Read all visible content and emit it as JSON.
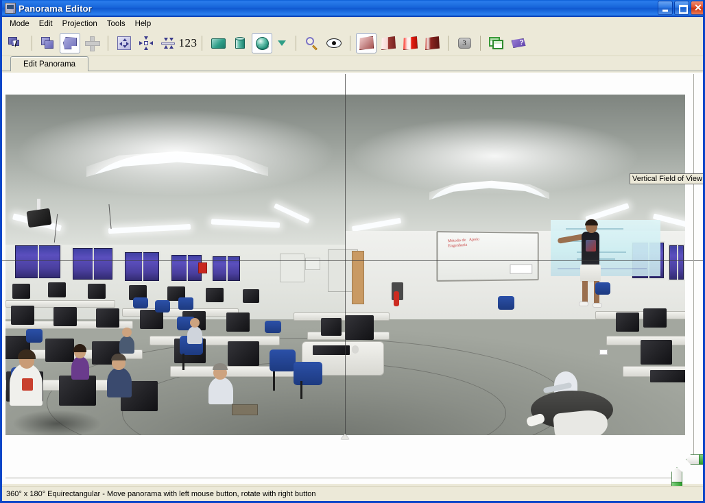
{
  "window": {
    "title": "Panorama Editor",
    "icon": "application-icon",
    "buttons": {
      "minimize": "minimize-button",
      "maximize": "maximize-restore-button",
      "close": "✕"
    }
  },
  "menubar": {
    "items": [
      {
        "label": "Mode"
      },
      {
        "label": "Edit"
      },
      {
        "label": "Projection"
      },
      {
        "label": "Tools"
      },
      {
        "label": "Help"
      }
    ]
  },
  "toolbar": {
    "groups": [
      {
        "name": "selection",
        "items": [
          {
            "icon": "select-arrow-icon",
            "label": "Select",
            "selected": false
          },
          {
            "icon": "layers-icon",
            "label": "Layers",
            "selected": false
          },
          {
            "icon": "shape-region-icon",
            "label": "Region",
            "selected": true
          },
          {
            "icon": "crosshair-add-icon",
            "label": "Add Point",
            "selected": false
          }
        ]
      },
      {
        "name": "transform",
        "items": [
          {
            "icon": "move-all-directions-icon",
            "label": "Move",
            "selected": false
          },
          {
            "icon": "center-shrink-icon",
            "label": "Center",
            "selected": false
          },
          {
            "icon": "vertical-fit-icon",
            "label": "Vertical Fit",
            "selected": false
          },
          {
            "icon": "numeric-values-icon",
            "label": "123",
            "selected": false
          }
        ]
      },
      {
        "name": "projection",
        "items": [
          {
            "icon": "rectangle-projection-icon",
            "label": "Equirectangular",
            "selected": false
          },
          {
            "icon": "cylinder-projection-icon",
            "label": "Cylindrical",
            "selected": false
          },
          {
            "icon": "sphere-projection-icon",
            "label": "Spherical",
            "selected": true
          },
          {
            "icon": "chevron-down-icon",
            "label": "More Projections",
            "selected": false
          }
        ]
      },
      {
        "name": "view",
        "items": [
          {
            "icon": "magnifier-icon",
            "label": "Zoom",
            "selected": false
          },
          {
            "icon": "eye-preview-icon",
            "label": "Preview",
            "selected": false
          }
        ]
      },
      {
        "name": "quads",
        "items": [
          {
            "icon": "quad-shaded-icon",
            "label": "Shading 1",
            "selected": true
          },
          {
            "icon": "quad-half-icon",
            "label": "Shading 2",
            "selected": false
          },
          {
            "icon": "quad-bright-icon",
            "label": "Shading 3",
            "selected": false
          },
          {
            "icon": "quad-dark-icon",
            "label": "Shading 4",
            "selected": false
          }
        ]
      },
      {
        "name": "misc",
        "items": [
          {
            "icon": "count-badge-icon",
            "label": "3",
            "selected": false
          }
        ]
      },
      {
        "name": "help",
        "items": [
          {
            "icon": "window-preview-icon",
            "label": "Preview Window",
            "selected": false
          },
          {
            "icon": "help-book-icon",
            "label": "Help",
            "selected": false
          }
        ]
      }
    ]
  },
  "tabs": [
    {
      "label": "Edit Panorama",
      "active": true
    }
  ],
  "canvas": {
    "tooltip": "Vertical Field of View",
    "scene_description": "360 degree equirectangular panorama of a computer lab classroom with rows of desktop computers, seated people, blue office chairs, a whiteboard, a projected presentation screen and a presenter pointing at it",
    "crosshair": {
      "horizontal_label": "horizon-line",
      "vertical_label": "center-line"
    },
    "sliders": {
      "vertical_fov": "vertical-fov-slider",
      "horizontal_fov": "horizontal-fov-slider"
    }
  },
  "statusbar": {
    "text": "360° x 180° Equirectangular - Move panorama with left mouse button, rotate with right button"
  },
  "colors": {
    "titlebar_start": "#2a7cec",
    "titlebar_end": "#0b4fc0",
    "chrome": "#ece9d8",
    "accent_teal": "#2e9e88",
    "accent_green": "#2e9e2e",
    "accent_purple": "#5c3fa8",
    "accent_red": "#b11208"
  }
}
